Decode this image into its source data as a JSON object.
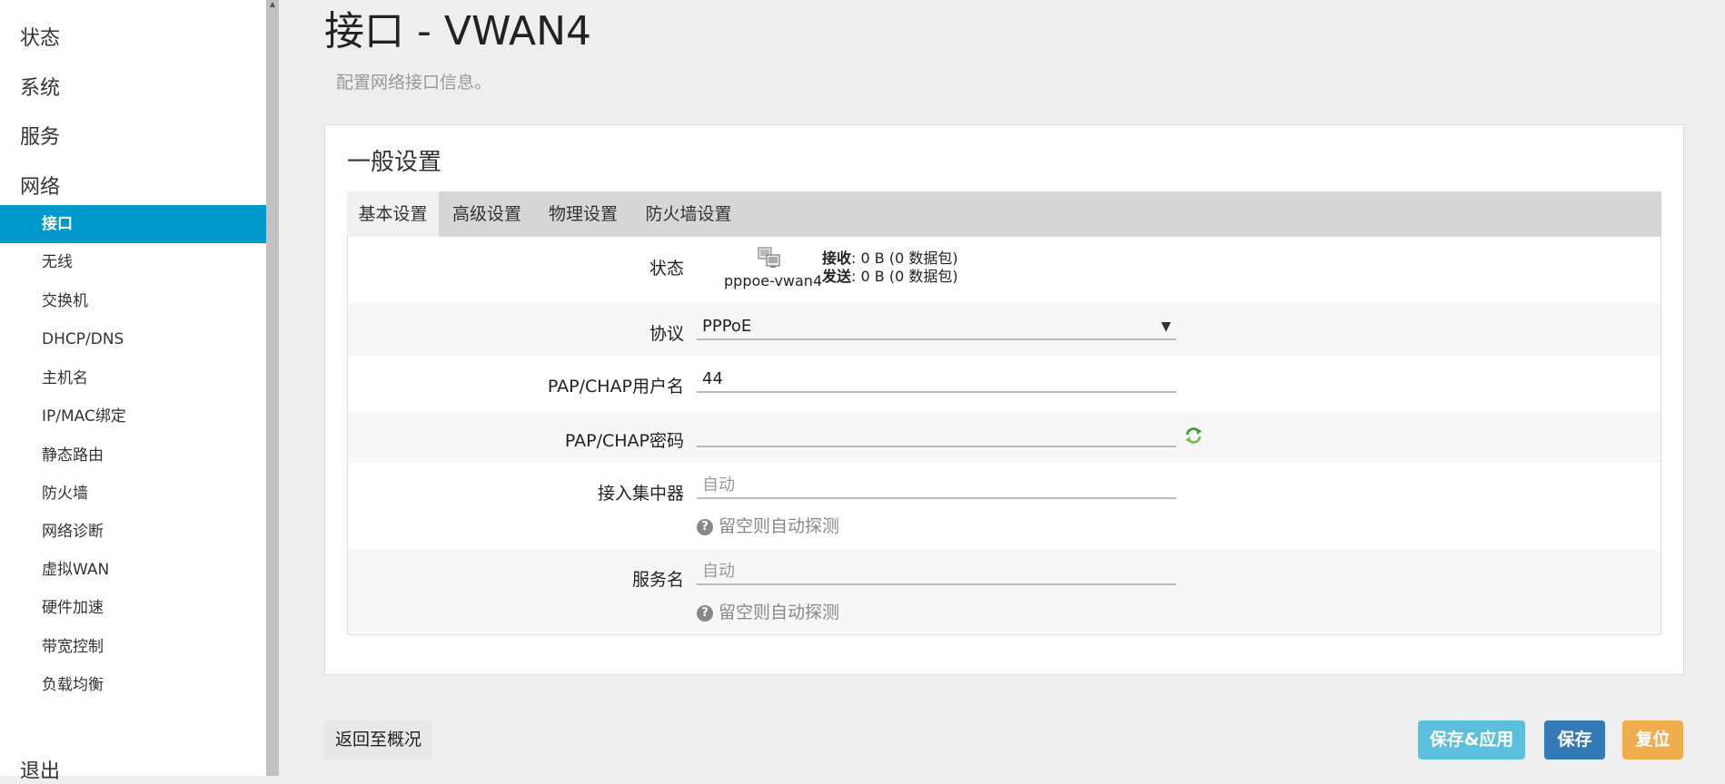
{
  "sidebar": {
    "top_items": [
      "状态",
      "系统",
      "服务",
      "网络"
    ],
    "sub_items": [
      "接口",
      "无线",
      "交换机",
      "DHCP/DNS",
      "主机名",
      "IP/MAC绑定",
      "静态路由",
      "防火墙",
      "网络诊断",
      "虚拟WAN",
      "硬件加速",
      "带宽控制",
      "负载均衡"
    ],
    "active_sub": "接口",
    "logout": "退出"
  },
  "header": {
    "title": "接口 - VWAN4",
    "description": "配置网络接口信息。"
  },
  "section": {
    "title": "一般设置",
    "tabs": [
      "基本设置",
      "高级设置",
      "物理设置",
      "防火墙设置"
    ],
    "active_tab": "基本设置"
  },
  "form": {
    "status": {
      "label": "状态",
      "ifname": "pppoe-vwan4",
      "rx_label": "接收",
      "rx_value": ": 0 B (0 数据包)",
      "tx_label": "发送",
      "tx_value": ": 0 B (0 数据包)",
      "icon": "network-interface-icon"
    },
    "protocol": {
      "label": "协议",
      "value": "PPPoE",
      "arrow": "▼"
    },
    "username": {
      "label": "PAP/CHAP用户名",
      "value": "44"
    },
    "password": {
      "label": "PAP/CHAP密码",
      "value": "",
      "icon": "refresh-icon"
    },
    "concentrator": {
      "label": "接入集中器",
      "placeholder": "自动",
      "hint": "留空则自动探测"
    },
    "service": {
      "label": "服务名",
      "placeholder": "自动",
      "hint": "留空则自动探测"
    },
    "hint_icon": "?"
  },
  "buttons": {
    "back": "返回至概况",
    "save_apply": "保存&应用",
    "save": "保存",
    "reset": "复位"
  },
  "colors": {
    "accent": "#0099cc",
    "apply": "#5bc0de",
    "save": "#337ab7",
    "reset": "#f0ad4e"
  }
}
